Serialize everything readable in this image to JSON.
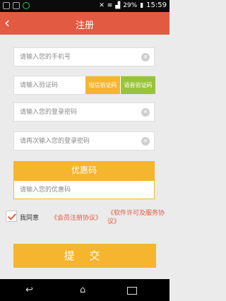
{
  "status_bar": {
    "battery": "29%",
    "time": "15:59"
  },
  "header": {
    "back_icon": "back-chevron",
    "title": "注册"
  },
  "form": {
    "phone_placeholder": "请输入您的手机号",
    "code_placeholder": "请输入验证码",
    "sms_code_button": "短信验证码",
    "voice_code_button": "语音验证码",
    "password_placeholder": "请输入您的登录密码",
    "password_confirm_placeholder": "请再次输入您的登录密码"
  },
  "coupon": {
    "title": "优惠码",
    "placeholder": "请输入您的优惠码"
  },
  "agreement": {
    "checked": true,
    "prefix": "我同意",
    "member_link": "《会员注册协议》",
    "license_link": "《软件许可及服务协议》"
  },
  "submit_label": "提 交",
  "colors": {
    "primary": "#e35a43",
    "orange": "#f6b52e",
    "green": "#98c43d"
  }
}
